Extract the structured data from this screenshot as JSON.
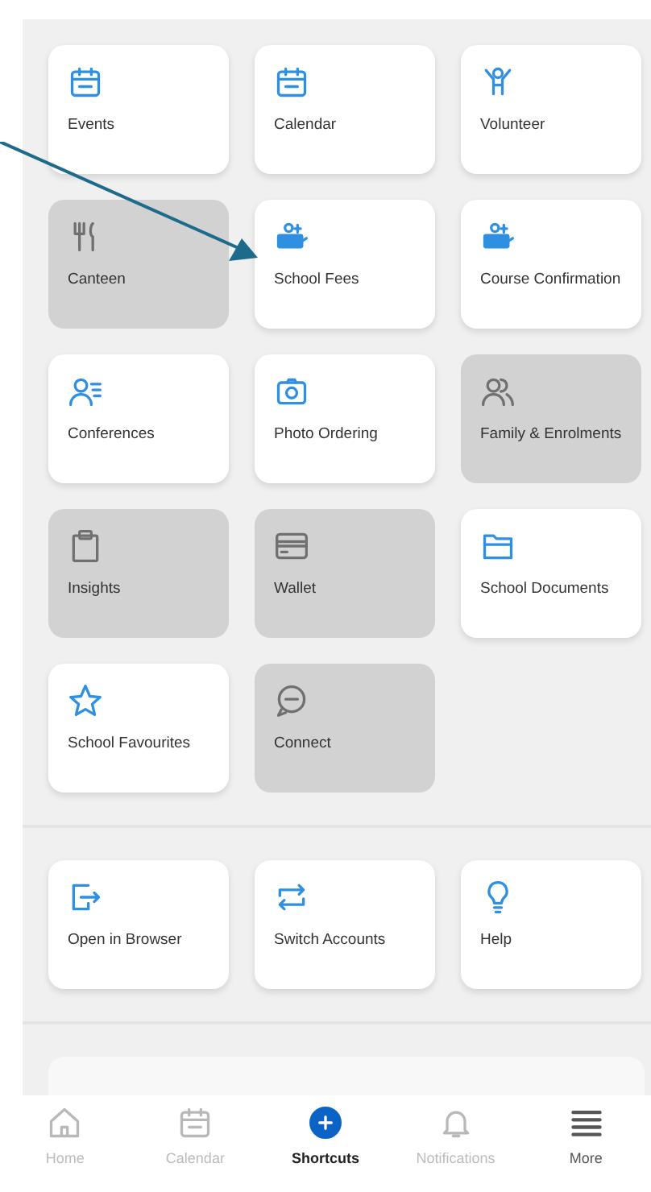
{
  "shortcuts": [
    {
      "label": "Events",
      "disabled": false
    },
    {
      "label": "Calendar",
      "disabled": false
    },
    {
      "label": "Volunteer",
      "disabled": false
    },
    {
      "label": "Canteen",
      "disabled": true
    },
    {
      "label": "School Fees",
      "disabled": false
    },
    {
      "label": "Course Confirmation",
      "disabled": false
    },
    {
      "label": "Conferences",
      "disabled": false
    },
    {
      "label": "Photo Ordering",
      "disabled": false
    },
    {
      "label": "Family & Enrolments",
      "disabled": true
    },
    {
      "label": "Insights",
      "disabled": true
    },
    {
      "label": "Wallet",
      "disabled": true
    },
    {
      "label": "School Documents",
      "disabled": false
    },
    {
      "label": "School Favourites",
      "disabled": false
    },
    {
      "label": "Connect",
      "disabled": true
    }
  ],
  "actions": [
    {
      "label": "Open in Browser"
    },
    {
      "label": "Switch Accounts"
    },
    {
      "label": "Help"
    }
  ],
  "nav": [
    {
      "label": "Home",
      "selected": false,
      "disabled": true
    },
    {
      "label": "Calendar",
      "selected": false,
      "disabled": true
    },
    {
      "label": "Shortcuts",
      "selected": true,
      "disabled": false
    },
    {
      "label": "Notifications",
      "selected": false,
      "disabled": true
    },
    {
      "label": "More",
      "selected": false,
      "disabled": false
    }
  ]
}
